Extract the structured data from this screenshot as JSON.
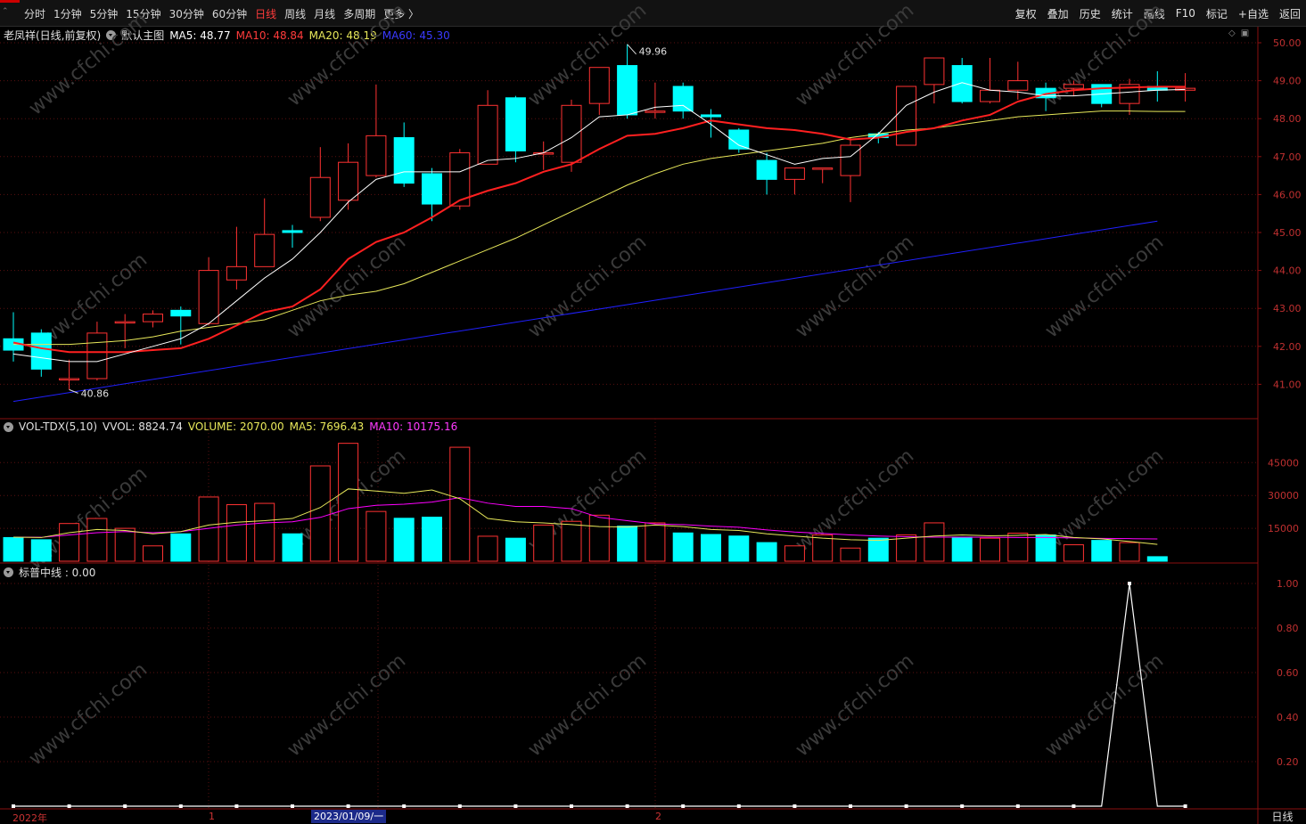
{
  "toolbar": {
    "periods": [
      "分时",
      "1分钟",
      "5分钟",
      "15分钟",
      "30分钟",
      "60分钟",
      "日线",
      "周线",
      "月线",
      "多周期",
      "更多 〉"
    ],
    "active_period": "日线",
    "actions": [
      "复权",
      "叠加",
      "历史",
      "统计",
      "画线",
      "F10",
      "标记",
      "+自选",
      "返回"
    ]
  },
  "main_pane": {
    "title": "老凤祥(日线,前复权)",
    "indicator": "默认主图",
    "ma5": "MA5: 48.77",
    "ma10": "MA10: 48.84",
    "ma20": "MA20: 48.19",
    "ma60": "MA60: 45.30",
    "high_marker": "49.96",
    "low_marker": "40.86",
    "y_ticks": [
      "50.00",
      "49.00",
      "48.00",
      "47.00",
      "46.00",
      "45.00",
      "44.00",
      "43.00",
      "42.00",
      "41.00"
    ]
  },
  "volume_pane": {
    "title": "VOL-TDX(5,10)",
    "vvol": "VVOL: 8824.74",
    "volume": "VOLUME: 2070.00",
    "ma5": "MA5: 7696.43",
    "ma10": "MA10: 10175.16",
    "y_ticks": [
      "45000",
      "30000",
      "15000"
    ]
  },
  "indicator_pane": {
    "title": "标普中线 : 0.00",
    "y_ticks": [
      "1.00",
      "0.80",
      "0.60",
      "0.40",
      "0.20"
    ]
  },
  "date_axis": {
    "year_label": "2022年",
    "month_1": "1",
    "selected_date": "2023/01/09/一",
    "month_2": "2"
  },
  "period_label": "日线",
  "watermark": "www.cfchi.com",
  "colors": {
    "up": "#ff3232",
    "down": "#00ffff",
    "ma5": "#ffffff",
    "ma10": "#ff2020",
    "ma20": "#e8e85a",
    "ma60": "#2020ff",
    "vol_ma10": "#ff00ff",
    "grid": "#5a1010"
  },
  "chart_data": {
    "type": "candlestick",
    "candles": [
      {
        "o": 42.2,
        "c": 41.9,
        "h": 42.9,
        "l": 41.6
      },
      {
        "o": 42.35,
        "c": 41.4,
        "h": 42.45,
        "l": 41.2
      },
      {
        "o": 41.15,
        "c": 41.15,
        "h": 41.65,
        "l": 40.86
      },
      {
        "o": 41.15,
        "c": 42.35,
        "h": 42.65,
        "l": 41.1
      },
      {
        "o": 42.65,
        "c": 42.65,
        "h": 42.85,
        "l": 41.95
      },
      {
        "o": 42.65,
        "c": 42.85,
        "h": 42.95,
        "l": 42.5
      },
      {
        "o": 42.95,
        "c": 42.8,
        "h": 43.05,
        "l": 42.05
      },
      {
        "o": 42.6,
        "c": 44.0,
        "h": 44.35,
        "l": 42.55
      },
      {
        "o": 43.75,
        "c": 44.1,
        "h": 45.15,
        "l": 43.5
      },
      {
        "o": 44.1,
        "c": 44.95,
        "h": 45.9,
        "l": 44.1
      },
      {
        "o": 45.05,
        "c": 45.0,
        "h": 45.2,
        "l": 44.6
      },
      {
        "o": 45.4,
        "c": 46.45,
        "h": 47.25,
        "l": 45.3
      },
      {
        "o": 45.85,
        "c": 46.85,
        "h": 47.35,
        "l": 45.6
      },
      {
        "o": 46.5,
        "c": 47.55,
        "h": 48.9,
        "l": 46.45
      },
      {
        "o": 47.5,
        "c": 46.3,
        "h": 47.9,
        "l": 46.2
      },
      {
        "o": 46.55,
        "c": 45.75,
        "h": 46.7,
        "l": 45.3
      },
      {
        "o": 45.7,
        "c": 47.1,
        "h": 47.2,
        "l": 45.6
      },
      {
        "o": 46.8,
        "c": 48.35,
        "h": 48.75,
        "l": 46.8
      },
      {
        "o": 48.55,
        "c": 47.15,
        "h": 48.6,
        "l": 46.85
      },
      {
        "o": 47.1,
        "c": 47.1,
        "h": 47.4,
        "l": 46.65
      },
      {
        "o": 46.85,
        "c": 48.35,
        "h": 48.5,
        "l": 46.6
      },
      {
        "o": 48.4,
        "c": 49.35,
        "h": 49.35,
        "l": 48.1
      },
      {
        "o": 49.4,
        "c": 48.1,
        "h": 49.96,
        "l": 48.0
      },
      {
        "o": 48.2,
        "c": 48.2,
        "h": 48.95,
        "l": 48.0
      },
      {
        "o": 48.85,
        "c": 48.2,
        "h": 48.95,
        "l": 48.0
      },
      {
        "o": 48.1,
        "c": 48.05,
        "h": 48.25,
        "l": 47.5
      },
      {
        "o": 47.7,
        "c": 47.2,
        "h": 47.75,
        "l": 47.1
      },
      {
        "o": 46.9,
        "c": 46.4,
        "h": 47.1,
        "l": 46.0
      },
      {
        "o": 46.4,
        "c": 46.7,
        "h": 46.7,
        "l": 46.0
      },
      {
        "o": 46.7,
        "c": 46.7,
        "h": 46.7,
        "l": 46.3
      },
      {
        "o": 46.5,
        "c": 47.3,
        "h": 47.5,
        "l": 45.8
      },
      {
        "o": 47.6,
        "c": 47.5,
        "h": 47.65,
        "l": 47.35
      },
      {
        "o": 47.3,
        "c": 48.85,
        "h": 48.85,
        "l": 47.3
      },
      {
        "o": 48.9,
        "c": 49.6,
        "h": 49.6,
        "l": 48.4
      },
      {
        "o": 49.4,
        "c": 48.45,
        "h": 49.6,
        "l": 48.4
      },
      {
        "o": 48.45,
        "c": 48.75,
        "h": 49.6,
        "l": 48.4
      },
      {
        "o": 48.75,
        "c": 49.0,
        "h": 49.5,
        "l": 48.5
      },
      {
        "o": 48.8,
        "c": 48.55,
        "h": 48.95,
        "l": 48.2
      },
      {
        "o": 48.8,
        "c": 48.9,
        "h": 49.0,
        "l": 48.6
      },
      {
        "o": 48.9,
        "c": 48.4,
        "h": 48.9,
        "l": 48.3
      },
      {
        "o": 48.4,
        "c": 48.9,
        "h": 49.05,
        "l": 48.1
      },
      {
        "o": 48.85,
        "c": 48.75,
        "h": 49.25,
        "l": 48.45
      },
      {
        "o": 48.75,
        "c": 48.8,
        "h": 49.2,
        "l": 48.45
      }
    ],
    "ma5": [
      41.8,
      41.7,
      41.6,
      41.6,
      41.8,
      42.0,
      42.2,
      42.6,
      43.2,
      43.8,
      44.3,
      45.0,
      45.8,
      46.4,
      46.6,
      46.6,
      46.6,
      46.9,
      46.95,
      47.1,
      47.5,
      48.05,
      48.1,
      48.3,
      48.35,
      47.85,
      47.3,
      47.05,
      46.8,
      46.95,
      47.0,
      47.6,
      48.35,
      48.7,
      48.95,
      48.75,
      48.7,
      48.6,
      48.6,
      48.65,
      48.7,
      48.75,
      48.77
    ],
    "ma10": [
      42.1,
      41.95,
      41.85,
      41.85,
      41.85,
      41.9,
      41.95,
      42.2,
      42.55,
      42.9,
      43.05,
      43.5,
      44.3,
      44.75,
      45.0,
      45.4,
      45.85,
      46.1,
      46.3,
      46.6,
      46.8,
      47.2,
      47.55,
      47.6,
      47.75,
      47.95,
      47.85,
      47.75,
      47.7,
      47.6,
      47.45,
      47.5,
      47.65,
      47.75,
      47.95,
      48.1,
      48.45,
      48.65,
      48.75,
      48.8,
      48.82,
      48.84,
      48.84
    ],
    "ma20": [
      42.05,
      42.05,
      42.05,
      42.1,
      42.15,
      42.25,
      42.4,
      42.5,
      42.6,
      42.7,
      42.95,
      43.2,
      43.35,
      43.45,
      43.65,
      43.95,
      44.25,
      44.55,
      44.85,
      45.2,
      45.55,
      45.9,
      46.25,
      46.55,
      46.8,
      46.95,
      47.05,
      47.15,
      47.25,
      47.35,
      47.5,
      47.6,
      47.7,
      47.75,
      47.85,
      47.95,
      48.05,
      48.1,
      48.15,
      48.2,
      48.2,
      48.19,
      48.19
    ],
    "ma60_start": 40.55,
    "ma60_end": 45.3,
    "volumes": [
      10800,
      9800,
      17200,
      19500,
      15000,
      7000,
      12500,
      29300,
      25800,
      26400,
      12500,
      43500,
      53800,
      22700,
      19600,
      20100,
      52000,
      11400,
      10500,
      16500,
      18200,
      21000,
      16000,
      17500,
      12900,
      12200,
      11500,
      8500,
      7000,
      12000,
      6000,
      10500,
      12000,
      17500,
      11000,
      10500,
      12800,
      12000,
      7500,
      9500,
      8500,
      2070
    ],
    "vol_ma5": [
      11000,
      10800,
      13000,
      14500,
      14000,
      12500,
      13500,
      16500,
      17800,
      18500,
      19500,
      24500,
      33000,
      32000,
      31000,
      32500,
      28500,
      19500,
      18000,
      17500,
      16700,
      15800,
      15600,
      16500,
      15800,
      14500,
      14000,
      12500,
      11500,
      10500,
      9800,
      9500,
      10500,
      11500,
      12000,
      11600,
      11800,
      12200,
      10800,
      10200,
      9000,
      7696
    ],
    "vol_ma10": [
      11000,
      10900,
      12000,
      13000,
      13500,
      13000,
      13500,
      15000,
      16500,
      17500,
      18000,
      20000,
      24000,
      25500,
      26000,
      27000,
      29000,
      26500,
      25000,
      25000,
      24000,
      20000,
      18500,
      17000,
      16700,
      16000,
      15500,
      14300,
      13300,
      12700,
      12000,
      11500,
      11200,
      11000,
      11000,
      10900,
      10800,
      10800,
      10600,
      10400,
      10300,
      10175
    ],
    "indicator_values": [
      0,
      0,
      0,
      0,
      0,
      0,
      0,
      0,
      0,
      0,
      0,
      0,
      0,
      0,
      0,
      0,
      0,
      0,
      0,
      0,
      0,
      0,
      0,
      0,
      0,
      0,
      0,
      0,
      0,
      0,
      0,
      0,
      0,
      0,
      0,
      0,
      0,
      0,
      0,
      0,
      1,
      0,
      0
    ]
  }
}
